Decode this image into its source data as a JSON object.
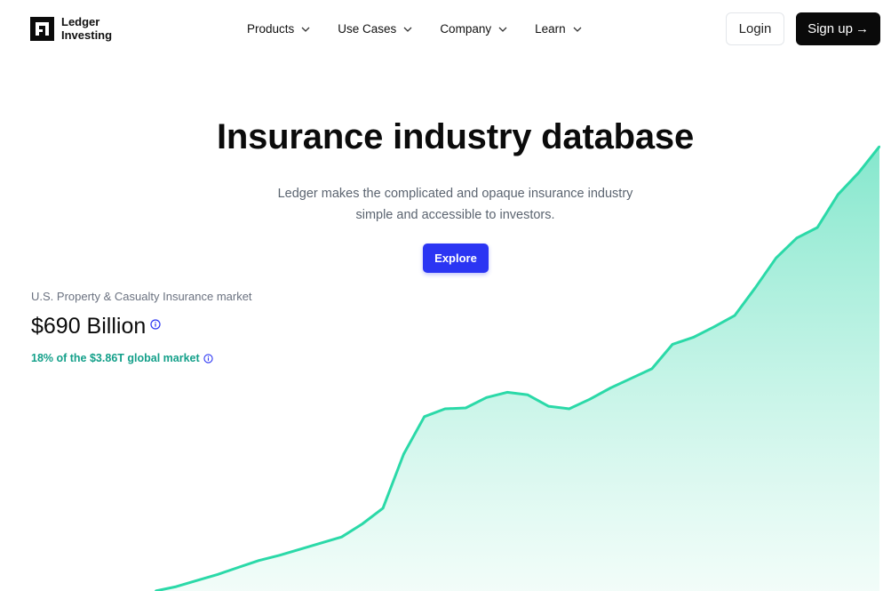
{
  "brand": {
    "line1": "Ledger",
    "line2": "Investing"
  },
  "nav": {
    "items": [
      {
        "label": "Products"
      },
      {
        "label": "Use Cases"
      },
      {
        "label": "Company"
      },
      {
        "label": "Learn"
      }
    ],
    "login_label": "Login",
    "signup_label": "Sign up",
    "signup_arrow": "→"
  },
  "hero": {
    "title": "Insurance industry database",
    "subtitle": "Ledger makes the complicated and opaque insurance industry simple and accessible to investors.",
    "cta_label": "Explore"
  },
  "stats": {
    "label": "U.S. Property & Casualty Insurance market",
    "value": "$690 Billion",
    "share": "18% of the $3.86T global market"
  },
  "colors": {
    "accent": "#2b35f3",
    "chart_line": "#2bd9a8",
    "share_text": "#14a08a",
    "dark_button": "#0a0a0a"
  },
  "chart_data": {
    "type": "area",
    "title": "",
    "xlabel": "",
    "ylabel": "",
    "x": [
      0,
      1,
      2,
      3,
      4,
      5,
      6,
      7,
      8,
      9,
      10,
      11,
      12,
      13,
      14,
      15,
      16,
      17,
      18,
      19,
      20,
      21,
      22,
      23,
      24,
      25,
      26,
      27,
      28,
      29,
      30,
      31,
      32,
      33,
      34,
      35
    ],
    "values": [
      0,
      5,
      12,
      19,
      27,
      35,
      41,
      48,
      55,
      62,
      77,
      95,
      157,
      200,
      209,
      210,
      222,
      228,
      225,
      212,
      209,
      220,
      233,
      244,
      255,
      283,
      291,
      303,
      316,
      348,
      382,
      405,
      417,
      455,
      480,
      510
    ],
    "ylim": [
      0,
      520
    ],
    "axes_visible": false,
    "grid": false,
    "legend": "none"
  }
}
